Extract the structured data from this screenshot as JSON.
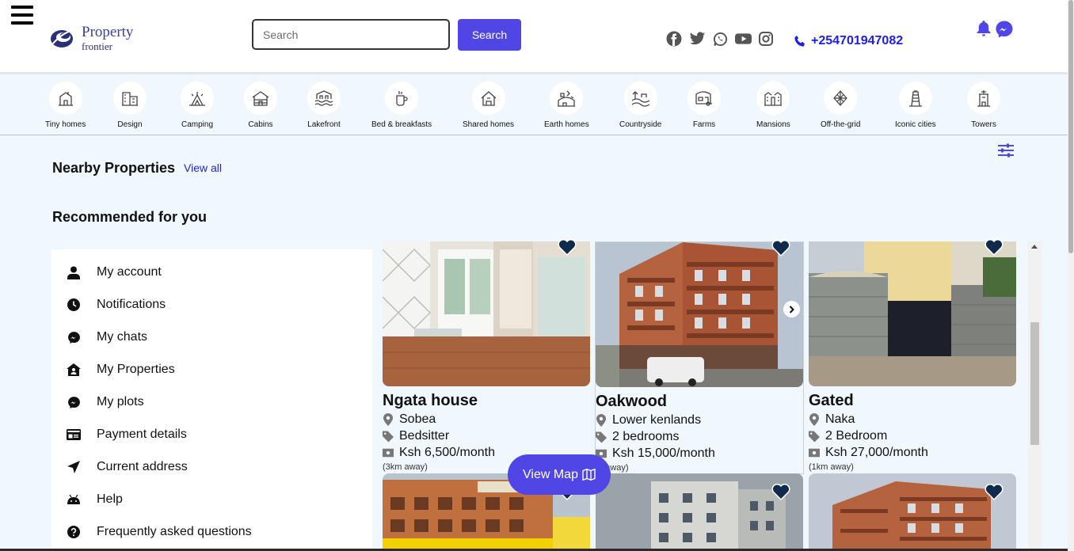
{
  "header": {
    "logo": {
      "line1": "Property",
      "line2": "frontier"
    },
    "search": {
      "placeholder": "Search",
      "button_label": "Search"
    },
    "socials": [
      "facebook-icon",
      "twitter-icon",
      "whatsapp-icon",
      "youtube-icon",
      "instagram-icon"
    ],
    "phone": "+254701947082",
    "accent_color": "#4f46e5"
  },
  "categories": [
    {
      "label": "Tiny homes",
      "icon": "tiny-home-icon"
    },
    {
      "label": "Design",
      "icon": "design-icon"
    },
    {
      "label": "Camping",
      "icon": "camping-icon"
    },
    {
      "label": "Cabins",
      "icon": "cabin-icon"
    },
    {
      "label": "Lakefront",
      "icon": "lakefront-icon"
    },
    {
      "label": "Bed & breakfasts",
      "icon": "bed-breakfast-icon"
    },
    {
      "label": "Shared homes",
      "icon": "shared-home-icon"
    },
    {
      "label": "Earth homes",
      "icon": "earth-home-icon"
    },
    {
      "label": "Countryside",
      "icon": "countryside-icon"
    },
    {
      "label": "Farms",
      "icon": "farm-icon"
    },
    {
      "label": "Mansions",
      "icon": "mansion-icon"
    },
    {
      "label": "Off-the-grid",
      "icon": "off-grid-icon"
    },
    {
      "label": "Iconic cities",
      "icon": "iconic-city-icon"
    },
    {
      "label": "Towers",
      "icon": "tower-icon"
    }
  ],
  "sections": {
    "nearby_title": "Nearby Properties",
    "view_all": "View all",
    "recommended_title": "Recommended for you"
  },
  "menu": [
    {
      "label": "My account",
      "icon": "user-icon"
    },
    {
      "label": "Notifications",
      "icon": "clock-icon"
    },
    {
      "label": "My chats",
      "icon": "messenger-icon"
    },
    {
      "label": "My Properties",
      "icon": "house-user-icon"
    },
    {
      "label": "My plots",
      "icon": "messenger-icon"
    },
    {
      "label": "Payment details",
      "icon": "card-icon"
    },
    {
      "label": "Current address",
      "icon": "location-arrow-icon"
    },
    {
      "label": "Help",
      "icon": "android-icon"
    },
    {
      "label": "Frequently asked questions",
      "icon": "question-circle-icon"
    }
  ],
  "properties": [
    {
      "name": "Ngata house",
      "location": "Sobea",
      "type": "Bedsitter",
      "price": "Ksh 6,500/month",
      "distance": "(3km away)"
    },
    {
      "name": "Oakwood",
      "location": "Lower kenlands",
      "type": "2 bedrooms",
      "price": "Ksh 15,000/month",
      "distance": "m away)"
    },
    {
      "name": "Gated",
      "location": "Naka",
      "type": "2 Bedroom",
      "price": "Ksh 27,000/month",
      "distance": "(1km away)"
    }
  ],
  "view_map": "View Map"
}
